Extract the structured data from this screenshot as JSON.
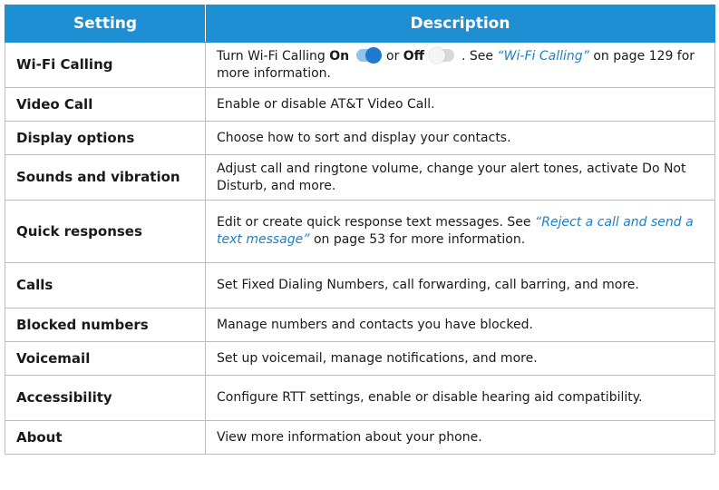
{
  "headers": {
    "setting": "Setting",
    "description": "Description"
  },
  "colors": {
    "header_bg": "#1f8fd4",
    "link": "#1f7fc6",
    "toggle_on": "#1f78d1",
    "toggle_off": "#d9d9d9"
  },
  "rows": [
    {
      "name": "Wi-Fi Calling",
      "d": {
        "t1": "Turn Wi-Fi Calling ",
        "on": "On",
        "t2": " or ",
        "off": "Off",
        "t3": ". See ",
        "link": "“Wi-Fi Calling”",
        "t4": " on page 129 for more information."
      }
    },
    {
      "name": "Video Call",
      "d": {
        "t1": "Enable or disable AT&T Video Call."
      }
    },
    {
      "name": "Display options",
      "d": {
        "t1": "Choose how to sort and display your contacts."
      }
    },
    {
      "name": "Sounds and vibration",
      "d": {
        "t1": "Adjust call and ringtone volume, change your alert tones, activate Do Not Disturb, and more."
      }
    },
    {
      "name": "Quick responses",
      "d": {
        "t1": "Edit or create quick response text messages. See ",
        "link": "“Reject a call and send a text message”",
        "t2": " on page 53 for more information."
      }
    },
    {
      "name": "Calls",
      "d": {
        "t1": "Set Fixed Dialing Numbers, call forwarding, call barring, and more."
      }
    },
    {
      "name": "Blocked numbers",
      "d": {
        "t1": "Manage numbers and contacts you have blocked."
      }
    },
    {
      "name": "Voicemail",
      "d": {
        "t1": "Set up voicemail, manage notifications, and more."
      }
    },
    {
      "name": "Accessibility",
      "d": {
        "t1": "Configure RTT settings, enable or disable hearing aid compatibility."
      }
    },
    {
      "name": "About",
      "d": {
        "t1": "View more information about your phone."
      }
    }
  ]
}
